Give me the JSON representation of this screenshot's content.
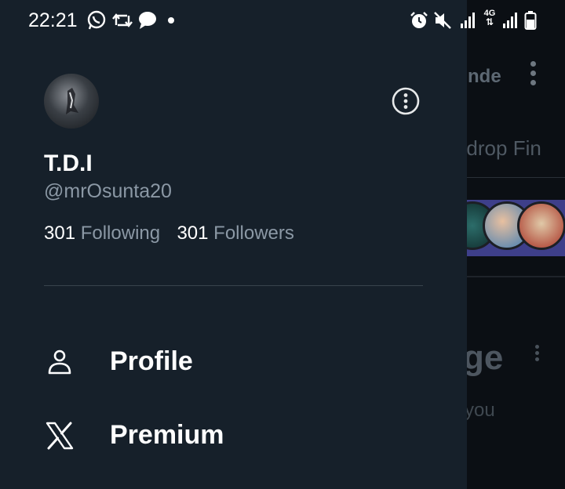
{
  "status_bar": {
    "time": "22:21",
    "left_icons": [
      "whatsapp-icon",
      "retweet-icon",
      "chat-bubble-icon",
      "dot-icon"
    ],
    "right_icons": [
      "alarm-icon",
      "mute-icon",
      "signal-icon",
      "4g-icon",
      "signal-icon",
      "battery-icon"
    ],
    "network": "4G"
  },
  "background": {
    "topbar_text": "nde",
    "row2_text": "irdrop Fin",
    "heading_text": "ge",
    "sub_text": "you"
  },
  "drawer": {
    "profile": {
      "display_name": "T.D.I",
      "handle": "@mrOsunta20",
      "following_count": "301",
      "following_label": "Following",
      "followers_count": "301",
      "followers_label": "Followers"
    },
    "menu": [
      {
        "label": "Profile",
        "icon": "person-icon"
      },
      {
        "label": "Premium",
        "icon": "x-logo-icon"
      }
    ]
  },
  "colors": {
    "drawer_bg": "#16202a",
    "secondary_text": "#8b98a5",
    "primary_text": "#ffffff",
    "banner": "#3e3f8a"
  }
}
